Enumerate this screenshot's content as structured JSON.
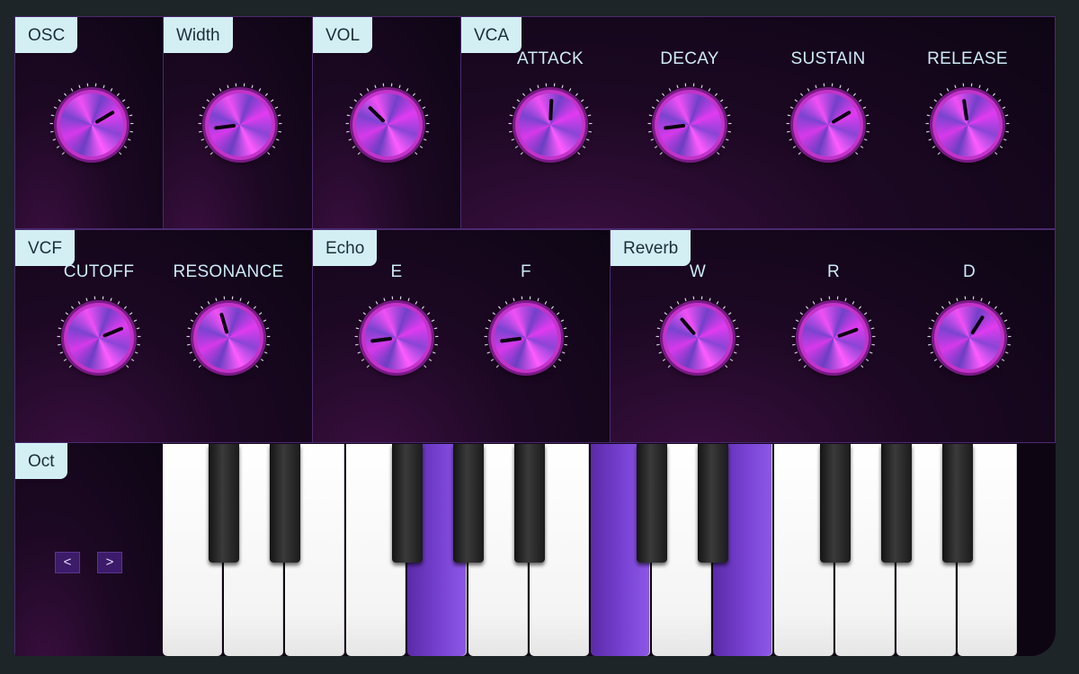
{
  "colors": {
    "background": "#1d2528",
    "panel_border": "#4a2a6e",
    "tab_bg": "#d3eff4",
    "knob_accent": "#e13bf0",
    "pressed_key": "#7b44d6"
  },
  "sections": {
    "osc": "OSC",
    "width": "Width",
    "vol": "VOL",
    "vca": "VCA",
    "vcf": "VCF",
    "echo": "Echo",
    "reverb": "Reverb",
    "oct": "Oct"
  },
  "knob_labels": {
    "attack": "ATTACK",
    "decay": "DECAY",
    "sustain": "SUSTAIN",
    "release": "RELEASE",
    "cutoff": "CUTOFF",
    "resonance": "RESONANCE",
    "echo_e": "E",
    "echo_f": "F",
    "reverb_w": "W",
    "reverb_r": "R",
    "reverb_d": "D"
  },
  "knob_values": {
    "osc": 0.72,
    "width": 0.14,
    "vol": 0.33,
    "attack": 0.51,
    "decay": 0.14,
    "sustain": 0.72,
    "release": 0.47,
    "cutoff": 0.75,
    "resonance": 0.44,
    "echo_e": 0.14,
    "echo_f": 0.14,
    "reverb_w": 0.35,
    "reverb_r": 0.76,
    "reverb_d": 0.62
  },
  "octave": {
    "down_label": "<",
    "up_label": ">"
  },
  "keyboard": {
    "white_keys": 14,
    "pressed_white": [
      4,
      7,
      9
    ]
  }
}
